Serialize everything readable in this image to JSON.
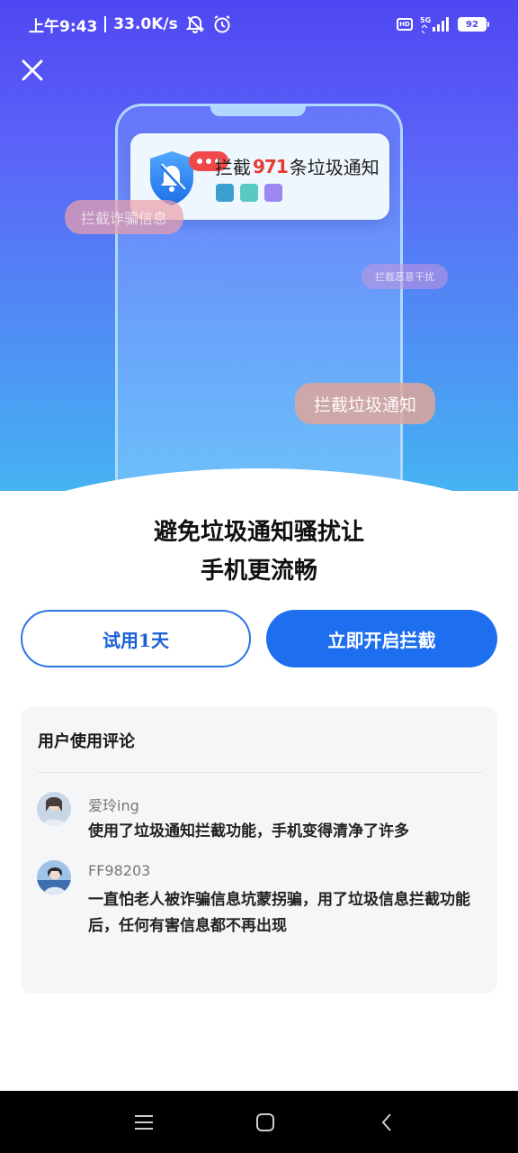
{
  "status_bar": {
    "time": "上午9:43",
    "speed": "33.0K/s",
    "network": "5G",
    "battery": "92",
    "hd": "HD"
  },
  "hero": {
    "notification": {
      "prefix": "拦截",
      "count": "971",
      "suffix": "条垃圾通知",
      "square_colors": [
        "#3b9fd0",
        "#5ac9c4",
        "#9a87f0"
      ]
    },
    "tags": {
      "fraud": "拦截诈骗信息",
      "harass": "拦截恶意干扰",
      "spam": "拦截垃圾通知"
    }
  },
  "headline": {
    "line1": "避免垃圾通知骚扰让",
    "line2": "手机更流畅"
  },
  "buttons": {
    "trial_label": "试用1天",
    "enable_label": "立即开启拦截"
  },
  "reviews": {
    "title": "用户使用评论",
    "items": [
      {
        "user": "爱玲ing",
        "text": "使用了垃圾通知拦截功能，手机变得清净了许多"
      },
      {
        "user": "FF98203",
        "text": "一直怕老人被诈骗信息坑蒙拐骗，用了垃圾信息拦截功能后，任何有害信息都不再出现"
      }
    ]
  },
  "colors": {
    "accent": "#1e6ff0",
    "hero_top": "#4f47f2",
    "hero_bottom": "#45b3f2",
    "alert_red": "#e53935"
  },
  "icons": {
    "close": "close-icon",
    "mute": "bell-muted-icon",
    "alarm": "alarm-icon",
    "shield": "shield-bell-icon",
    "nav_menu": "menu-icon",
    "nav_home": "home-icon",
    "nav_back": "back-icon"
  }
}
